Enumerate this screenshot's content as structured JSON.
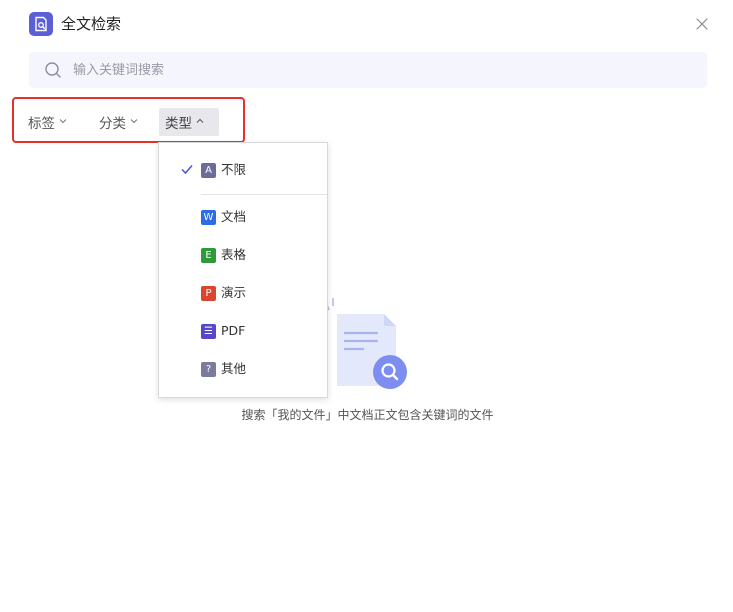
{
  "header": {
    "title": "全文检索",
    "app_icon": "document-search-icon",
    "close_icon": "close-icon",
    "accent_color": "#5a5fd6"
  },
  "search": {
    "placeholder": "输入关键词搜索",
    "value": "",
    "icon": "search-icon"
  },
  "filters": [
    {
      "label": "标签",
      "expanded": false
    },
    {
      "label": "分类",
      "expanded": false
    },
    {
      "label": "类型",
      "expanded": true
    }
  ],
  "type_menu": {
    "selected": "不限",
    "items": [
      {
        "label": "不限",
        "badge": "A",
        "badge_color": "#6c6c9c",
        "checked": true
      },
      {
        "label": "文档",
        "badge": "W",
        "badge_color": "#2f6be6",
        "checked": false
      },
      {
        "label": "表格",
        "badge": "E",
        "badge_color": "#2e9a3c",
        "checked": false
      },
      {
        "label": "演示",
        "badge": "P",
        "badge_color": "#d9452f",
        "checked": false
      },
      {
        "label": "PDF",
        "badge": "☰",
        "badge_color": "#5747c9",
        "checked": false
      },
      {
        "label": "其他",
        "badge": "?",
        "badge_color": "#7b7b9e",
        "checked": false
      }
    ]
  },
  "empty_state": {
    "text": "搜索「我的文件」中文档正文包含关键词的文件",
    "icon": "empty-document-search-icon"
  }
}
